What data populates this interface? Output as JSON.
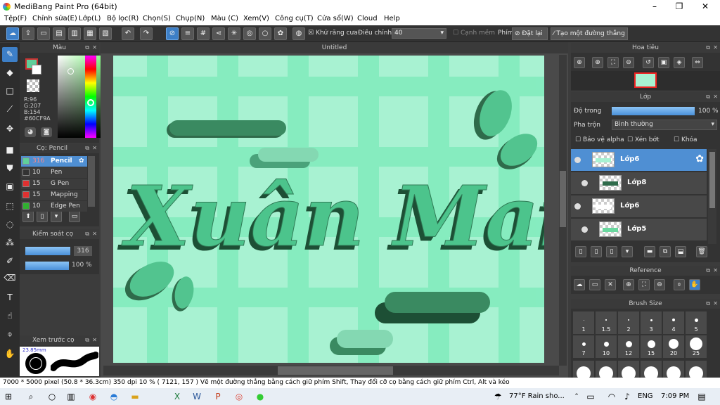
{
  "window": {
    "title": "MediBang Paint Pro (64bit)",
    "min": "–",
    "max": "❐",
    "close": "✕"
  },
  "menu": [
    "Tệp(F)",
    "Chỉnh sửa(E)",
    "Lớp(L)",
    "Bộ lọc(R)",
    "Chọn(S)",
    "Chụp(N)",
    "Màu (C)",
    "Xem(V)",
    "Công cụ(T)",
    "Cửa sổ(W)",
    "Cloud",
    "Help"
  ],
  "toolbar": {
    "antialias": "Khử răng cưa",
    "adjust": "Điều chỉnh",
    "adjust_value": "40",
    "soft_edge": "Cạnh mềm",
    "key_label": "Phím",
    "reset": "Đặt lại",
    "make_line": "Tạo một đường thẳng"
  },
  "color_panel": {
    "title": "Màu",
    "r": "R:96",
    "g": "G:207",
    "b": "B:154",
    "hex": "#60CF9A",
    "fg": "#60cf9a"
  },
  "brush_panel": {
    "title": "Cọ: Pencil",
    "items": [
      {
        "size": "316",
        "name": "Pencil",
        "color": "#60cf9a",
        "selected": true
      },
      {
        "size": "10",
        "name": "Pen",
        "color": "#333333",
        "selected": false
      },
      {
        "size": "15",
        "name": "G Pen",
        "color": "#e03030",
        "selected": false
      },
      {
        "size": "15",
        "name": "Mapping Pe",
        "color": "#e03030",
        "selected": false
      },
      {
        "size": "10",
        "name": "Edge Pen",
        "color": "#30b030",
        "selected": false
      }
    ]
  },
  "brush_control": {
    "title": "Kiểm soát cọ",
    "size": "316",
    "opacity": "100 %"
  },
  "preview": {
    "title": "Xem trước cọ",
    "size_label": "23.85mm"
  },
  "canvas": {
    "tab": "Untitled",
    "text": "Xuân Mai"
  },
  "navigator": {
    "title": "Hoa tiêu"
  },
  "layer_panel": {
    "title": "Lớp",
    "opacity_label": "Độ trong",
    "opacity_value": "100 %",
    "blend_label": "Pha trộn",
    "blend_value": "Bình thường",
    "protect_alpha": "Bảo vệ alpha",
    "clip": "Xén bớt",
    "lock": "Khóa",
    "layers": [
      {
        "name": "Lớp6",
        "selected": true
      },
      {
        "name": "Lớp8",
        "selected": false
      },
      {
        "name": "Lớp6",
        "selected": false
      },
      {
        "name": "Lớp5",
        "selected": false
      }
    ]
  },
  "reference": {
    "title": "Reference"
  },
  "brush_size": {
    "title": "Brush Size",
    "row1": [
      "1",
      "1.5",
      "2",
      "3",
      "4",
      "5"
    ],
    "row2": [
      "7",
      "10",
      "12",
      "15",
      "20",
      "25"
    ]
  },
  "status": {
    "text": "7000 * 5000 pixel   (50.8 * 36.3cm)   350 dpi   10 %   ( 7121, 157 )   Vẽ một đường thẳng bằng cách giữ phím Shift, Thay đổi cỡ cọ bằng cách giữ phím Ctrl, Alt và kéo"
  },
  "taskbar": {
    "weather": "77°F  Rain sho...",
    "lang": "ENG",
    "time": "7:09 PM"
  }
}
